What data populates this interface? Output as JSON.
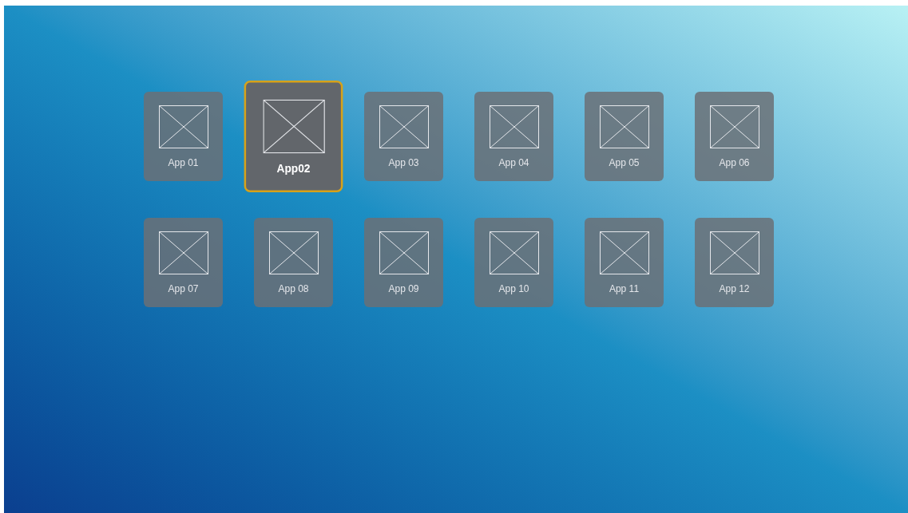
{
  "apps": [
    {
      "label": "App 01",
      "selected": false
    },
    {
      "label": "App02",
      "selected": true
    },
    {
      "label": "App 03",
      "selected": false
    },
    {
      "label": "App 04",
      "selected": false
    },
    {
      "label": "App 05",
      "selected": false
    },
    {
      "label": "App 06",
      "selected": false
    },
    {
      "label": "App 07",
      "selected": false
    },
    {
      "label": "App 08",
      "selected": false
    },
    {
      "label": "App 09",
      "selected": false
    },
    {
      "label": "App 10",
      "selected": false
    },
    {
      "label": "App 11",
      "selected": false
    },
    {
      "label": "App 12",
      "selected": false
    }
  ]
}
